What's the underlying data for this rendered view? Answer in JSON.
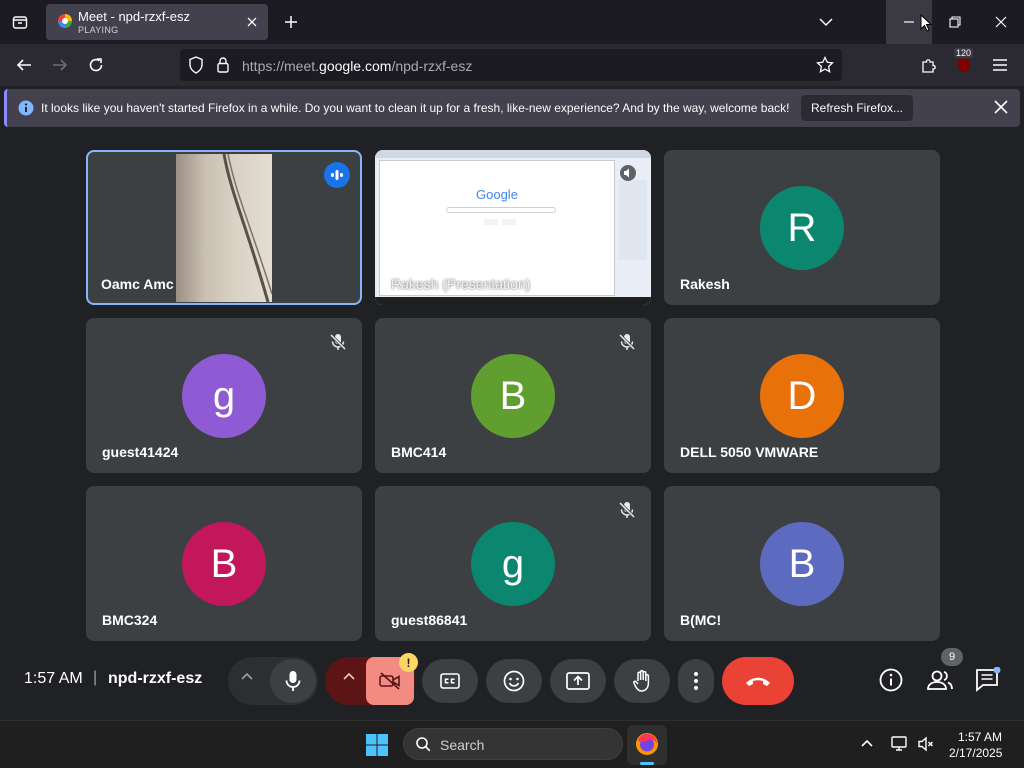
{
  "browser": {
    "tab": {
      "title": "Meet - npd-rzxf-esz",
      "subtitle": "PLAYING"
    },
    "url_prefix": "https://meet.",
    "url_domain": "google.com",
    "url_path": "/npd-rzxf-esz",
    "extension_badge": "120"
  },
  "notification": {
    "message": "It looks like you haven't started Firefox in a while. Do you want to clean it up for a fresh, like-new experience? And by the way, welcome back!",
    "button_label": "Refresh Firefox..."
  },
  "participants": [
    {
      "name": "Oamc Amc",
      "type": "video",
      "speaking": true
    },
    {
      "name": "Rakesh (Presentation)",
      "type": "screen"
    },
    {
      "name": "Rakesh",
      "initial": "R",
      "color": "#0b8770",
      "muted": false
    },
    {
      "name": "guest41424",
      "initial": "g",
      "color": "#8e5bd4",
      "muted": true
    },
    {
      "name": "BMC414",
      "initial": "B",
      "color": "#5f9e2f",
      "muted": true
    },
    {
      "name": "DELL 5050 VMWARE",
      "initial": "D",
      "color": "#e8710a",
      "muted": false
    },
    {
      "name": "BMC324",
      "initial": "B",
      "color": "#c2185b",
      "muted": false
    },
    {
      "name": "guest86841",
      "initial": "g",
      "color": "#0b8770",
      "muted": true
    },
    {
      "name": "B(MC!",
      "initial": "B",
      "color": "#5c6bc0",
      "muted": false
    }
  ],
  "presentation_preview": {
    "logo": "Google"
  },
  "meeting": {
    "time": "1:57 AM",
    "separator": "|",
    "code": "npd-rzxf-esz",
    "people_count": "9",
    "camera_warning": "!"
  },
  "taskbar": {
    "search_placeholder": "Search",
    "clock_time": "1:57 AM",
    "clock_date": "2/17/2025"
  },
  "colors": {
    "meet_bg": "#202124",
    "tile_bg": "#3c4043",
    "end_call": "#ea4335",
    "camera_off": "#f28b82",
    "speaking_border": "#8ab4f8"
  }
}
